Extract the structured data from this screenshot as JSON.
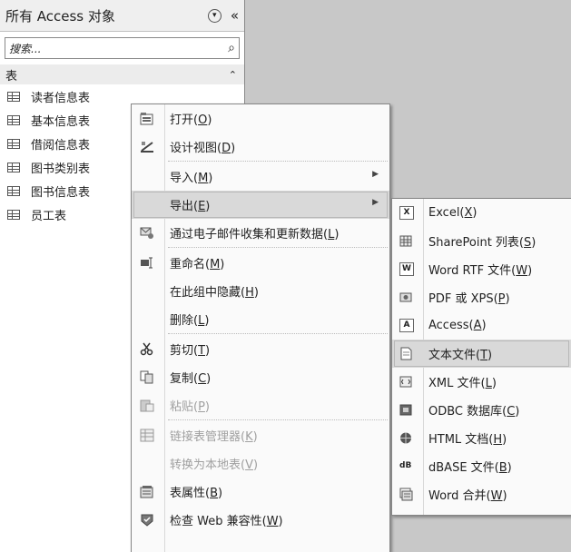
{
  "nav": {
    "title": "所有 Access 对象",
    "dropdown_glyph": "▾",
    "collapse_glyph": "«",
    "search_placeholder": "搜索...",
    "search_glyph": "⌕",
    "group_label": "表",
    "group_toggle_glyph": "⌃",
    "items": [
      "读者信息表",
      "基本信息表",
      "借阅信息表",
      "图书类别表",
      "图书信息表",
      "员工表"
    ]
  },
  "context_menu": {
    "open": {
      "label": "打开(",
      "key": "O",
      "end": ")"
    },
    "design": {
      "label": "设计视图(",
      "key": "D",
      "end": ")"
    },
    "import": {
      "label": "导入(",
      "key": "M",
      "end": ")"
    },
    "export": {
      "label": "导出(",
      "key": "E",
      "end": ")"
    },
    "email": {
      "label": "通过电子邮件收集和更新数据(",
      "key": "L",
      "end": ")"
    },
    "rename": {
      "label": "重命名(",
      "key": "M",
      "end": ")"
    },
    "hide": {
      "label": "在此组中隐藏(",
      "key": "H",
      "end": ")"
    },
    "delete": {
      "label": "删除(",
      "key": "L",
      "end": ")"
    },
    "cut": {
      "label": "剪切(",
      "key": "T",
      "end": ")"
    },
    "copy": {
      "label": "复制(",
      "key": "C",
      "end": ")"
    },
    "paste": {
      "label": "粘贴(",
      "key": "P",
      "end": ")"
    },
    "linked_table_mgr": {
      "label": "链接表管理器(",
      "key": "K",
      "end": ")"
    },
    "convert_local": {
      "label": "转换为本地表(",
      "key": "V",
      "end": ")"
    },
    "properties": {
      "label": "表属性(",
      "key": "B",
      "end": ")"
    },
    "web_compat": {
      "label": "检查 Web 兼容性(",
      "key": "W",
      "end": ")"
    },
    "submenu_arrow": "▶"
  },
  "export_menu": {
    "excel": {
      "label": "Excel(",
      "key": "X",
      "end": ")"
    },
    "sharepoint": {
      "label": "SharePoint 列表(",
      "key": "S",
      "end": ")"
    },
    "word_rtf": {
      "label": "Word RTF 文件(",
      "key": "W",
      "end": ")"
    },
    "pdf_xps": {
      "label": "PDF 或 XPS(",
      "key": "P",
      "end": ")"
    },
    "access": {
      "label": "Access(",
      "key": "A",
      "end": ")"
    },
    "text_file": {
      "label": "文本文件(",
      "key": "T",
      "end": ")"
    },
    "xml_file": {
      "label": "XML 文件(",
      "key": "L",
      "end": ")"
    },
    "odbc": {
      "label": "ODBC 数据库(",
      "key": "C",
      "end": ")"
    },
    "html": {
      "label": "HTML 文档(",
      "key": "H",
      "end": ")"
    },
    "dbase": {
      "label": "dBASE 文件(",
      "key": "B",
      "end": ")"
    },
    "word_merge": {
      "label": "Word 合并(",
      "key": "W",
      "end": ")"
    },
    "icon_text": {
      "excel": "X",
      "word": "W",
      "access": "A",
      "dbase": "dB"
    }
  }
}
